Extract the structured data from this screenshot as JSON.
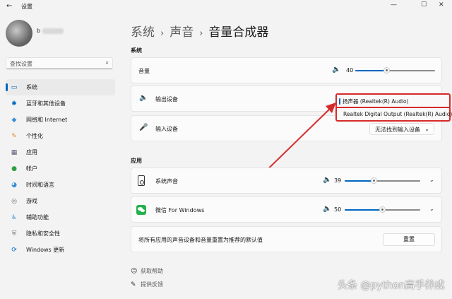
{
  "window": {
    "title": "设置",
    "back_icon": "←",
    "minimize_icon": "—",
    "maximize_icon": "☐",
    "close_icon": "✕"
  },
  "profile": {
    "username": "b"
  },
  "search": {
    "placeholder": "查找设置",
    "icon": "⌕"
  },
  "sidebar": {
    "items": [
      {
        "label": "系统",
        "icon": "▭",
        "color": "#0067c0"
      },
      {
        "label": "蓝牙和其他设备",
        "icon": "✱",
        "color": "#0067c0"
      },
      {
        "label": "网络和 Internet",
        "icon": "◆",
        "color": "#3a8fd6"
      },
      {
        "label": "个性化",
        "icon": "✎",
        "color": "#e08a2e"
      },
      {
        "label": "应用",
        "icon": "▦",
        "color": "#5a5a7a"
      },
      {
        "label": "帐户",
        "icon": "●",
        "color": "#2ea043"
      },
      {
        "label": "时间和语言",
        "icon": "◕",
        "color": "#3a8fd6"
      },
      {
        "label": "游戏",
        "icon": "◎",
        "color": "#707070"
      },
      {
        "label": "辅助功能",
        "icon": "♿",
        "color": "#3a8fd6"
      },
      {
        "label": "隐私和安全性",
        "icon": "⛨",
        "color": "#707070"
      },
      {
        "label": "Windows 更新",
        "icon": "⟳",
        "color": "#0067c0"
      }
    ]
  },
  "breadcrumb": {
    "part1": "系统",
    "part2": "声音",
    "current": "音量合成器",
    "sep": "›"
  },
  "system_section": {
    "heading": "系统",
    "volume": {
      "label": "音量",
      "value": "40",
      "level": 0.4,
      "icon": "🔈"
    },
    "output": {
      "label": "输出设备",
      "icon": "🔈",
      "options": [
        "扬声器 (Realtek(R) Audio)",
        "Realtek Digital Output (Realtek(R) Audio)"
      ]
    },
    "input": {
      "label": "输入设备",
      "icon": "🎤",
      "value": "无法找到输入设备",
      "chevron": "⌄"
    }
  },
  "apps_section": {
    "heading": "应用",
    "apps": [
      {
        "label": "系统声音",
        "value": "39",
        "level": 0.39,
        "vol_icon": "🔈",
        "chevron": "⌄"
      },
      {
        "label": "微信 For Windows",
        "value": "50",
        "level": 0.5,
        "vol_icon": "🔈",
        "chevron": "⌄"
      }
    ],
    "reset": {
      "text": "将所有应用的声音设备和音量重置为推荐的默认值",
      "button": "重置"
    }
  },
  "footer": {
    "help": {
      "label": "获取帮助",
      "icon": "☺"
    },
    "feedback": {
      "label": "提供反馈",
      "icon": "✎"
    }
  },
  "watermark": "头条 @python高手养成",
  "colors": {
    "accent": "#0067c0",
    "highlight": "#d62b2b"
  }
}
